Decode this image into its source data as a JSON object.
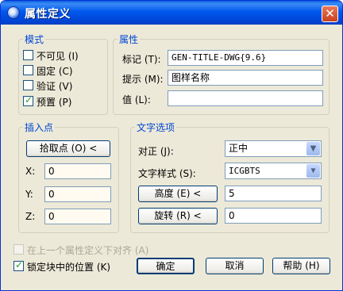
{
  "title": "属性定义",
  "mode": {
    "title": "模式",
    "options": [
      {
        "label": "不可见 (I)",
        "checked": false
      },
      {
        "label": "固定 (C)",
        "checked": false
      },
      {
        "label": "验证 (V)",
        "checked": false
      },
      {
        "label": "预置 (P)",
        "checked": true
      }
    ]
  },
  "attribute": {
    "title": "属性",
    "tag_label": "标记 (T):",
    "tag_value": "GEN-TITLE-DWG{9.6}",
    "prompt_label": "提示 (M):",
    "prompt_value": "图样名称",
    "value_label": "值 (L):",
    "value_value": ""
  },
  "insertion": {
    "title": "插入点",
    "pick_button": "拾取点 (O) <",
    "x_label": "X:",
    "x_value": "0",
    "y_label": "Y:",
    "y_value": "0",
    "z_label": "Z:",
    "z_value": "0"
  },
  "text": {
    "title": "文字选项",
    "justify_label": "对正 (J):",
    "justify_value": "正中",
    "style_label": "文字样式 (S):",
    "style_value": "ICGBTS",
    "height_button": "高度 (E) <",
    "height_value": "5",
    "rotation_button": "旋转 (R) <",
    "rotation_value": "0"
  },
  "align_below": {
    "label": "在上一个属性定义下对齐 (A)",
    "checked": false,
    "enabled": false
  },
  "lock_position": {
    "label": "锁定块中的位置 (K)",
    "checked": true
  },
  "buttons": {
    "ok": "确定",
    "cancel": "取消",
    "help": "帮助 (H)"
  }
}
